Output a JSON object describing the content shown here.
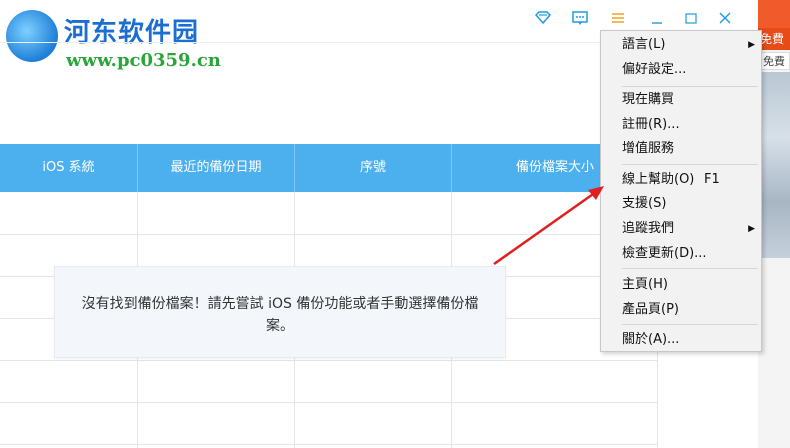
{
  "watermark": {
    "title": "河东软件园",
    "url": "www.pc0359.cn"
  },
  "titlebar": {
    "icons": [
      "wifi-icon",
      "feedback-icon",
      "menu-icon",
      "minimize-icon",
      "maximize-icon",
      "close-icon"
    ],
    "accent": "#1e9be0"
  },
  "table": {
    "header_color": "#4db0ee",
    "columns": [
      "iOS 系統",
      "最近的備份日期",
      "序號",
      "備份檔案大小"
    ]
  },
  "empty_message": "沒有找到備份檔案！請先嘗試 iOS 備份功能或者手動選擇備份檔案。",
  "side_window": {
    "badge_red": "免費",
    "badge_white": "免費"
  },
  "context_menu": {
    "items": [
      {
        "label": "語言(L)",
        "submenu": true
      },
      {
        "label": "偏好設定..."
      },
      {
        "separator": true
      },
      {
        "label": "現在購買"
      },
      {
        "label": "註冊(R)..."
      },
      {
        "label": "增值服務"
      },
      {
        "separator": true
      },
      {
        "label": "線上幫助(O)",
        "shortcut": "F1"
      },
      {
        "label": "支援(S)"
      },
      {
        "label": "追蹤我們",
        "submenu": true
      },
      {
        "label": "檢查更新(D)..."
      },
      {
        "separator": true
      },
      {
        "label": "主頁(H)"
      },
      {
        "label": "產品頁(P)"
      },
      {
        "separator": true
      },
      {
        "label": "關於(A)..."
      }
    ]
  },
  "annotation_color": "#e02020"
}
